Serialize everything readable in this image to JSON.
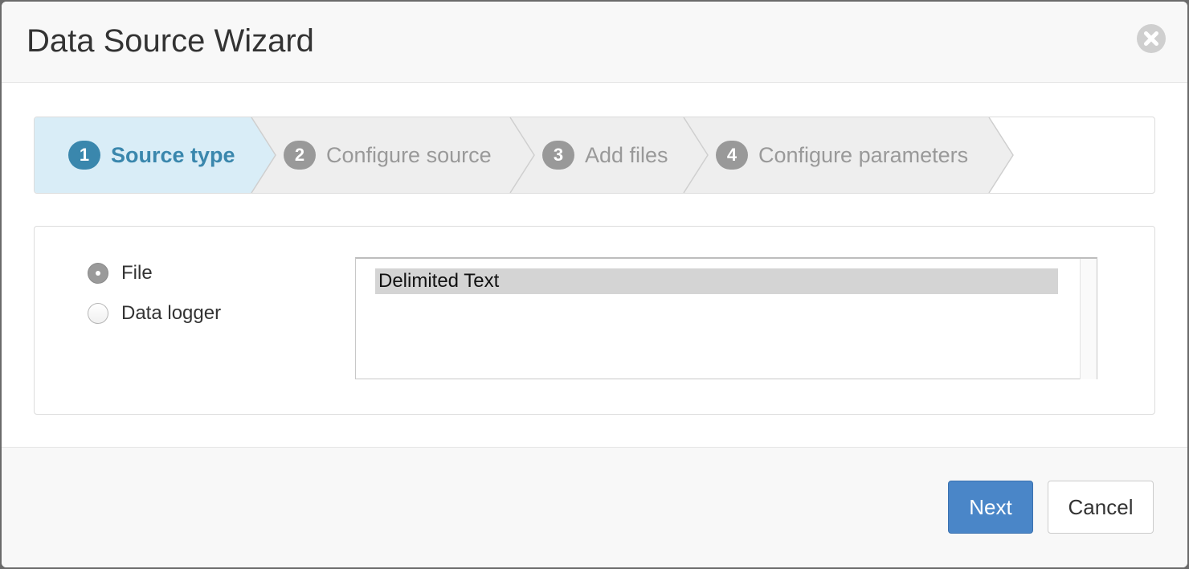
{
  "dialog": {
    "title": "Data Source Wizard",
    "close_icon": "close-circle-icon"
  },
  "wizard": {
    "active_step": 1,
    "steps": [
      {
        "number": "1",
        "label": "Source type",
        "state": "active"
      },
      {
        "number": "2",
        "label": "Configure source",
        "state": "inactive"
      },
      {
        "number": "3",
        "label": "Add files",
        "state": "inactive"
      },
      {
        "number": "4",
        "label": "Configure parameters",
        "state": "inactive"
      }
    ]
  },
  "source": {
    "options": [
      {
        "label": "File",
        "checked": true
      },
      {
        "label": "Data logger",
        "checked": false
      }
    ],
    "list_items": [
      {
        "label": "Delimited Text",
        "selected": true
      }
    ]
  },
  "footer": {
    "next_label": "Next",
    "cancel_label": "Cancel"
  },
  "colors": {
    "active_step_bg": "#d9edf7",
    "active_step_text": "#3a87ad",
    "inactive_step_bg": "#eeeeee",
    "inactive_step_text": "#999999",
    "primary_button": "#4a86c8"
  }
}
